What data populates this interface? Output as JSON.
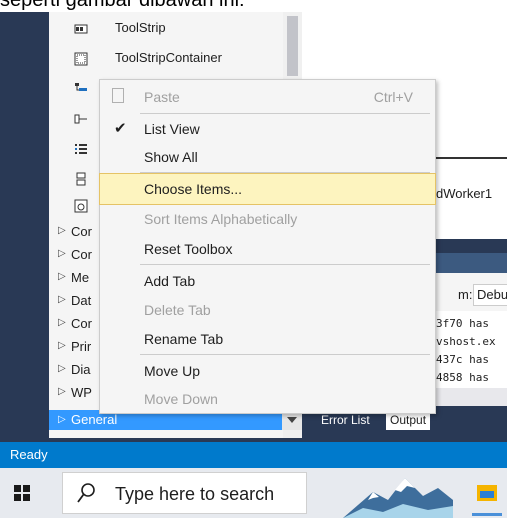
{
  "caption": {
    "text": "seperti gambar dibawah ini:"
  },
  "toolbox": {
    "items": [
      {
        "label": "ToolStrip",
        "icon": "toolstrip-icon"
      },
      {
        "label": "ToolStripContainer",
        "icon": "toolstripcontainer-icon"
      },
      {
        "label": "",
        "icon": "treeview-icon"
      },
      {
        "label": "",
        "icon": "trackbar-icon"
      },
      {
        "label": "",
        "icon": "listview-icon"
      },
      {
        "label": "",
        "icon": "layout-icon"
      },
      {
        "label": "",
        "icon": "webbrowser-icon"
      }
    ],
    "categories": [
      "Cor",
      "Cor",
      "Me",
      "Dat",
      "Cor",
      "Prir",
      "Dia",
      "WP"
    ],
    "general": {
      "label": "General"
    }
  },
  "context_menu": {
    "items": [
      {
        "label": "Paste",
        "shortcut": "Ctrl+V",
        "disabled": true,
        "icon": "paste-icon"
      },
      {
        "label": "List View",
        "checked": true
      },
      {
        "label": "Show All"
      },
      {
        "label": "Choose Items...",
        "highlighted": true
      },
      {
        "label": "Sort Items Alphabetically",
        "disabled": true
      },
      {
        "label": "Reset Toolbox"
      },
      {
        "label": "Add Tab"
      },
      {
        "label": "Delete Tab",
        "disabled": true
      },
      {
        "label": "Rename Tab"
      },
      {
        "label": "Move Up"
      },
      {
        "label": "Move Down",
        "disabled": true
      }
    ]
  },
  "designer": {
    "tray_text": "dWorker1"
  },
  "output": {
    "from_label": "m:",
    "from_value": "Debug",
    "lines": [
      "3f70 has",
      "vshost.ex",
      "437c has",
      "4858 has"
    ]
  },
  "bottom_tabs": {
    "error_list": "Error List",
    "output": "Output"
  },
  "status_bar": {
    "text": "Ready"
  },
  "taskbar": {
    "search_placeholder": "Type here to search"
  },
  "colors": {
    "vs_frame": "#293955",
    "status_blue": "#007acc",
    "selection_blue": "#3399ff",
    "menu_highlight": "#fdf4bf"
  }
}
